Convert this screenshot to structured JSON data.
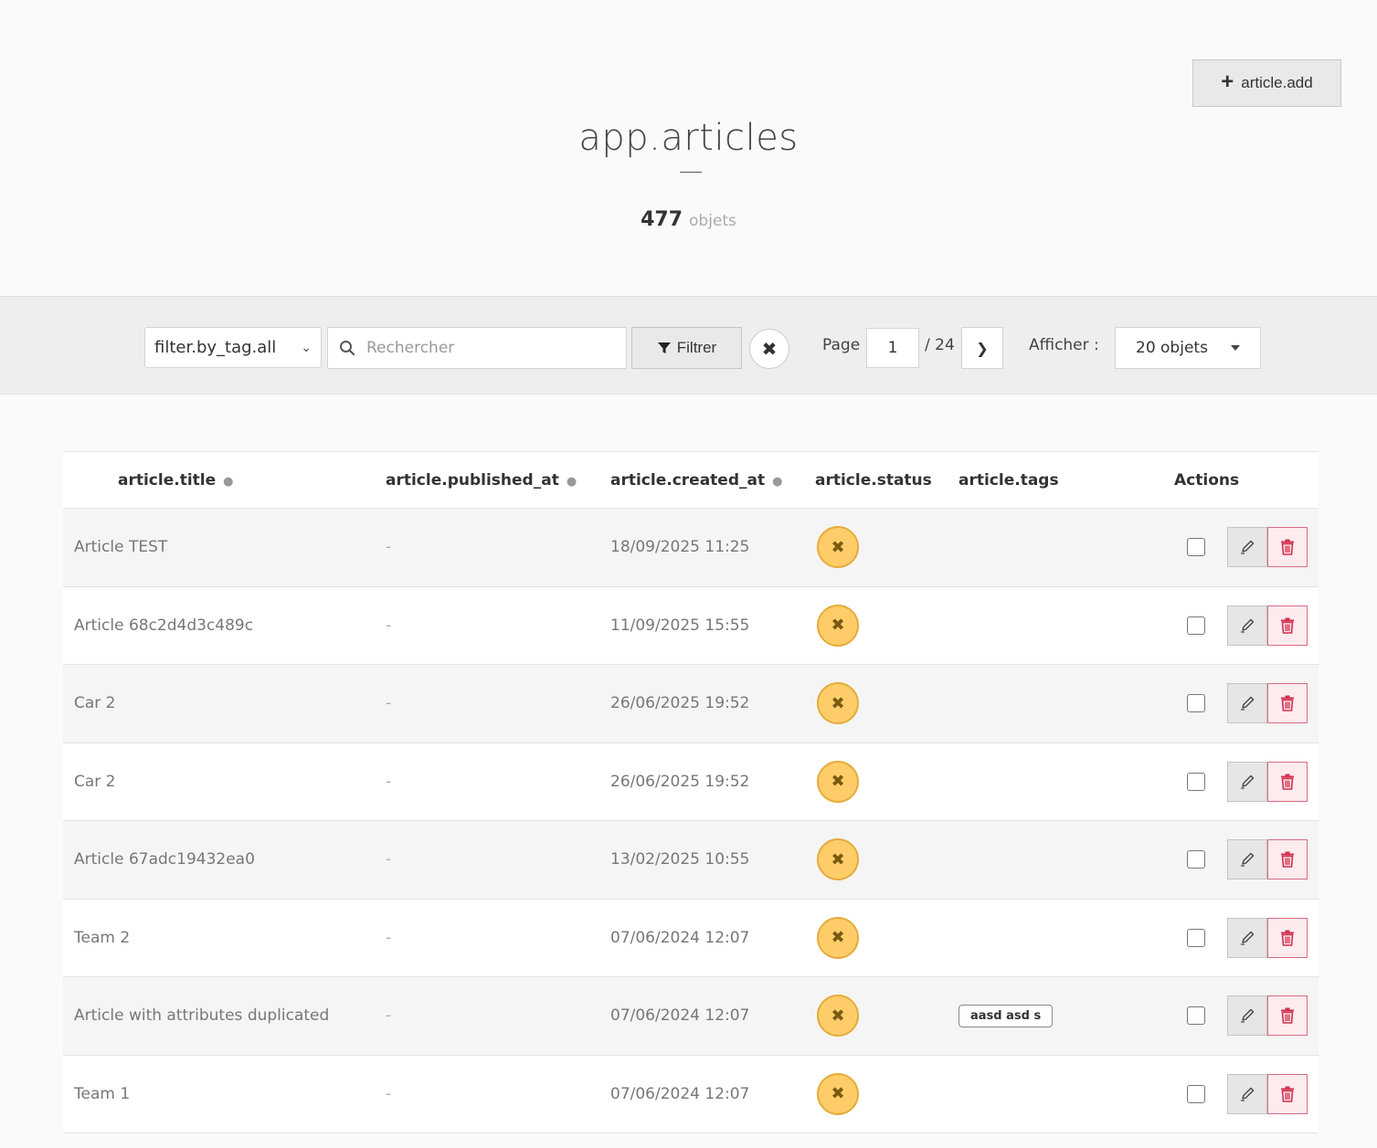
{
  "header": {
    "title": "app.articles",
    "count": "477",
    "count_unit": "objets",
    "add_button_label": "article.add"
  },
  "toolbar": {
    "tag_filter": "filter.by_tag.all",
    "search_placeholder": "Rechercher",
    "filter_button_label": "Filtrer",
    "page_label": "Page",
    "page_current": "1",
    "page_total": "/ 24",
    "show_label": "Afficher :",
    "per_page": "20 objets"
  },
  "table": {
    "headers": {
      "title": "article.title",
      "published_at": "article.published_at",
      "created_at": "article.created_at",
      "status": "article.status",
      "tags": "article.tags",
      "actions": "Actions"
    },
    "rows": [
      {
        "title": "Article TEST",
        "published_at": "-",
        "created_at": "18/09/2025 11:25",
        "tag": ""
      },
      {
        "title": "Article 68c2d4d3c489c",
        "published_at": "-",
        "created_at": "11/09/2025 15:55",
        "tag": ""
      },
      {
        "title": "Car 2",
        "published_at": "-",
        "created_at": "26/06/2025 19:52",
        "tag": ""
      },
      {
        "title": "Car 2",
        "published_at": "-",
        "created_at": "26/06/2025 19:52",
        "tag": ""
      },
      {
        "title": "Article 67adc19432ea0",
        "published_at": "-",
        "created_at": "13/02/2025 10:55",
        "tag": ""
      },
      {
        "title": "Team 2",
        "published_at": "-",
        "created_at": "07/06/2024 12:07",
        "tag": ""
      },
      {
        "title": "Article with attributes duplicated",
        "published_at": "-",
        "created_at": "07/06/2024 12:07",
        "tag": "aasd asd s"
      },
      {
        "title": "Team 1",
        "published_at": "-",
        "created_at": "07/06/2024 12:07",
        "tag": ""
      }
    ]
  },
  "colors": {
    "status_badge": "#fecd6a",
    "delete_accent": "#d0304f"
  }
}
